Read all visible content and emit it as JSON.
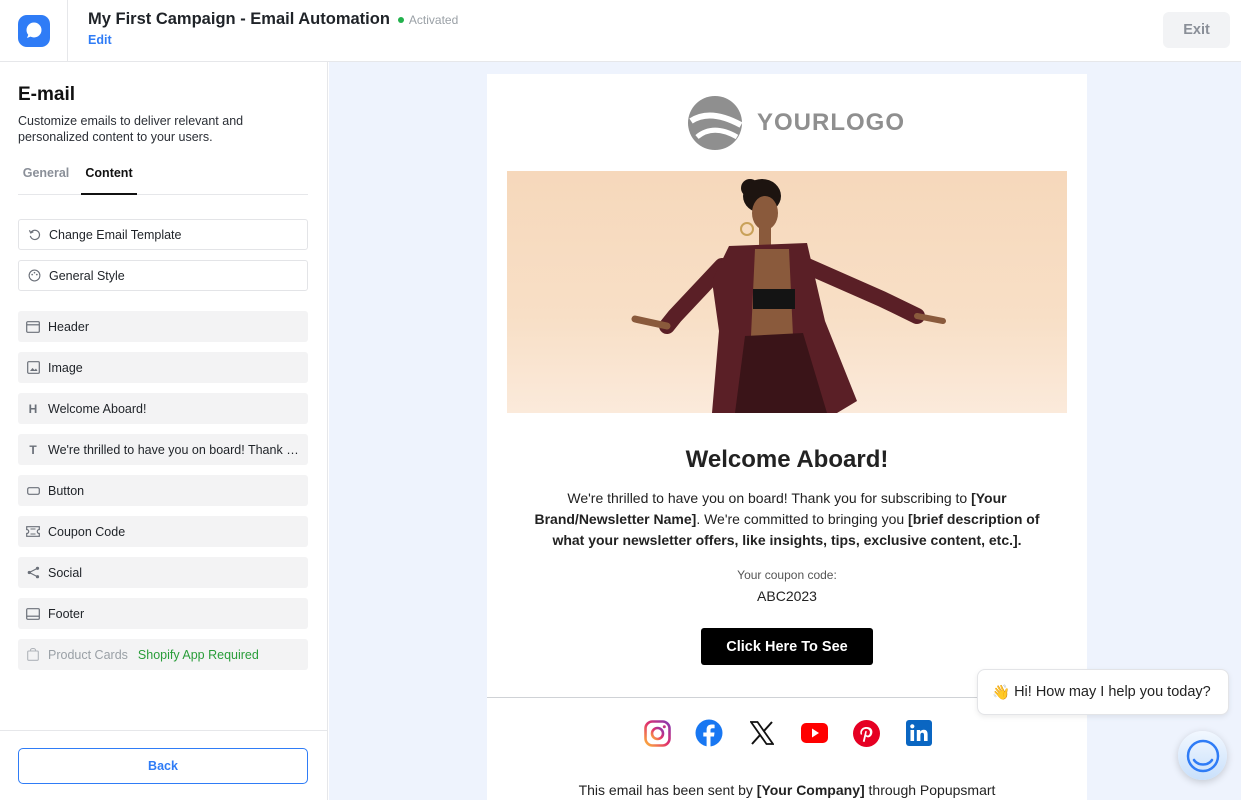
{
  "header": {
    "campaign_title": "My First Campaign - Email Automation",
    "status": "Activated",
    "status_color": "#22b14c",
    "edit_label": "Edit",
    "exit_label": "Exit",
    "accent": "#2f7cf6"
  },
  "panel": {
    "title": "E-mail",
    "description": "Customize emails to deliver relevant and personalized content to your users.",
    "tabs": [
      {
        "label": "General",
        "active": false
      },
      {
        "label": "Content",
        "active": true
      }
    ],
    "actions": [
      {
        "label": "Change Email Template",
        "icon": "refresh-icon"
      },
      {
        "label": "General Style",
        "icon": "palette-icon"
      }
    ],
    "blocks": [
      {
        "label": "Header",
        "icon": "header-layout-icon"
      },
      {
        "label": "Image",
        "icon": "image-icon"
      },
      {
        "label": "Welcome Aboard!",
        "icon": "heading-icon",
        "glyph": "H"
      },
      {
        "label": "We're thrilled to have you on board! Thank you for subscribing to [Your Brand/Newsletter Name]",
        "icon": "text-icon",
        "glyph": "T"
      },
      {
        "label": "Button",
        "icon": "button-icon"
      },
      {
        "label": "Coupon Code",
        "icon": "coupon-icon"
      },
      {
        "label": "Social",
        "icon": "share-icon"
      },
      {
        "label": "Footer",
        "icon": "footer-layout-icon"
      },
      {
        "label": "Product Cards",
        "icon": "shopping-bag-icon",
        "badge": "Shopify App Required",
        "disabled": true
      }
    ],
    "back_label": "Back"
  },
  "email": {
    "logo_text": "YOURLOGO",
    "heading": "Welcome Aboard!",
    "body_part1": "We're thrilled to have you on board! Thank you for subscribing to ",
    "body_bold1": "[Your Brand/Newsletter Name]",
    "body_part2": ". We're committed to bringing you ",
    "body_bold2": "[brief description of what your newsletter offers, like insights, tips, exclusive content, etc.].",
    "coupon_label": "Your coupon code:",
    "coupon_code": "ABC2023",
    "cta_label": "Click Here To See",
    "socials": [
      "instagram-icon",
      "facebook-icon",
      "x-icon",
      "youtube-icon",
      "pinterest-icon",
      "linkedin-icon"
    ],
    "footer_part1": "This email has been sent by ",
    "footer_bold": "[Your Company]",
    "footer_part2": " through Popupsmart"
  },
  "chat": {
    "greeting": "Hi! How may I help you today?",
    "wave": "👋"
  }
}
